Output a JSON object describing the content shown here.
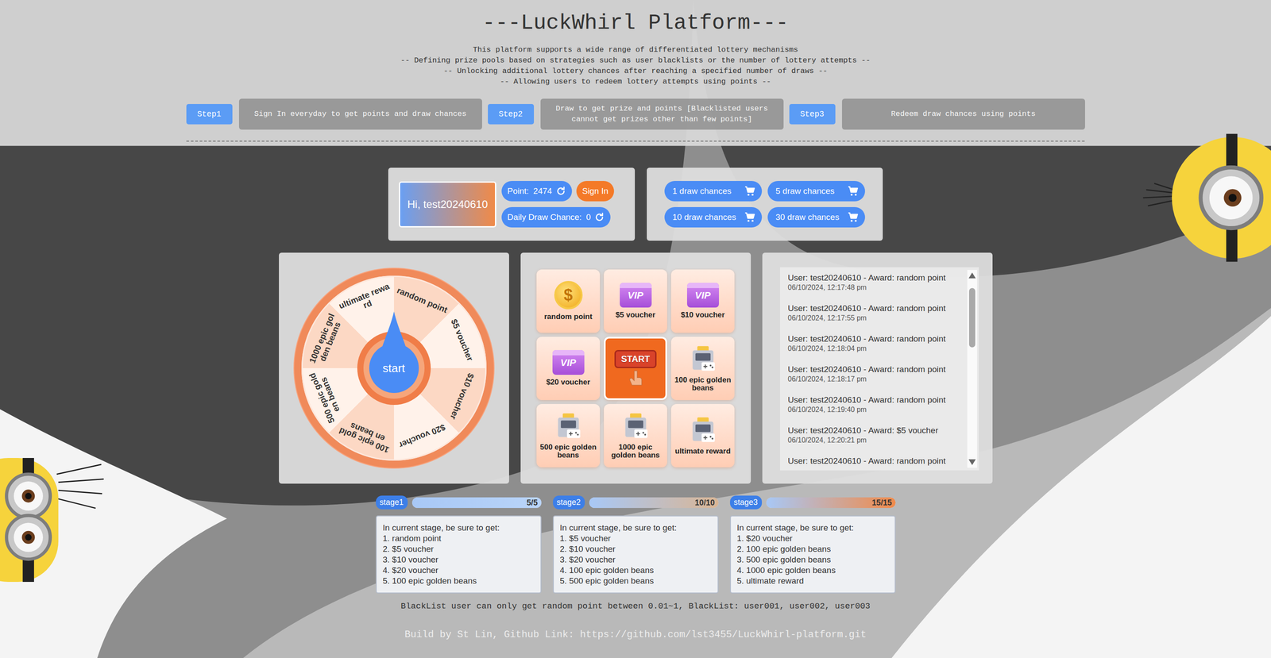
{
  "header": {
    "title": "---LuckWhirl Platform---",
    "description": [
      "This platform supports a wide range of differentiated lottery mechanisms",
      "-- Defining prize pools based on strategies such as user blacklists or the number of lottery attempts --",
      "-- Unlocking additional lottery chances after reaching a specified number of draws --",
      "-- Allowing users to redeem lottery attempts using points --"
    ]
  },
  "steps": [
    {
      "label": "Step1",
      "text": "Sign In everyday to get points and draw chances"
    },
    {
      "label": "Step2",
      "text": "Draw to get prize and points [Blacklisted users cannot get prizes other than few points]"
    },
    {
      "label": "Step3",
      "text": "Redeem draw chances using points"
    }
  ],
  "user": {
    "greeting": "Hi, test20240610",
    "point_label": "Point:",
    "points": "2474",
    "sign_in": "Sign In",
    "chance_label": "Daily Draw Chance:",
    "chances": "0"
  },
  "shop": [
    "1 draw chances",
    "5 draw chances",
    "10 draw chances",
    "30 draw chances"
  ],
  "wheel": {
    "button": "start",
    "segments": [
      "random point",
      "$5 voucher",
      "$10 voucher",
      "$20 voucher",
      "100 epic golden beans",
      "500 epic golden beans",
      "1000 epic golden beans",
      "ultimate reward"
    ]
  },
  "grid": [
    {
      "label": "random point",
      "kind": "coin",
      "badge": "$"
    },
    {
      "label": "$5 voucher",
      "kind": "vip",
      "badge": "VIP"
    },
    {
      "label": "$10 voucher",
      "kind": "vip",
      "badge": "VIP"
    },
    {
      "label": "$20 voucher",
      "kind": "vip",
      "badge": "VIP"
    },
    {
      "label": "",
      "kind": "start",
      "badge": "START"
    },
    {
      "label": "100 epic golden beans",
      "kind": "machine",
      "badge": ""
    },
    {
      "label": "500 epic golden beans",
      "kind": "machine",
      "badge": ""
    },
    {
      "label": "1000 epic golden beans",
      "kind": "machine",
      "badge": ""
    },
    {
      "label": "ultimate reward",
      "kind": "machine",
      "badge": ""
    }
  ],
  "records": [
    {
      "text": "User: test20240610 - Award: random point",
      "time": "06/10/2024, 12:17:48 pm"
    },
    {
      "text": "User: test20240610 - Award: random point",
      "time": "06/10/2024, 12:17:55 pm"
    },
    {
      "text": "User: test20240610 - Award: random point",
      "time": "06/10/2024, 12:18:04 pm"
    },
    {
      "text": "User: test20240610 - Award: random point",
      "time": "06/10/2024, 12:18:17 pm"
    },
    {
      "text": "User: test20240610 - Award: random point",
      "time": "06/10/2024, 12:19:40 pm"
    },
    {
      "text": "User: test20240610 - Award: $5 voucher",
      "time": "06/10/2024, 12:20:21 pm"
    },
    {
      "text": "User: test20240610 - Award: random point",
      "time": ""
    }
  ],
  "stages": [
    {
      "label": "stage1",
      "count": "5/5",
      "level": 1,
      "heading": "In current stage, be sure to get:",
      "items": [
        "1. random point",
        "2. $5 voucher",
        "3. $10 voucher",
        "4. $20 voucher",
        "5. 100 epic golden beans"
      ]
    },
    {
      "label": "stage2",
      "count": "10/10",
      "level": 1,
      "heading": "In current stage, be sure to get:",
      "items": [
        "1. $5 voucher",
        "2. $10 voucher",
        "3. $20 voucher",
        "4. 100 epic golden beans",
        "5. 500 epic golden beans"
      ]
    },
    {
      "label": "stage3",
      "count": "15/15",
      "level": 1,
      "heading": "In current stage, be sure to get:",
      "items": [
        "1. $20 voucher",
        "2. 100 epic golden beans",
        "3. 500 epic golden beans",
        "4. 1000 epic golden beans",
        "5. ultimate reward"
      ]
    }
  ],
  "blacklist_note": "BlackList user can only get random point between 0.01~1, BlackList: user001, user002, user003",
  "footer": "Build by St Lin, Github Link: https://github.com/lst3455/LuckWhirl-platform.git"
}
